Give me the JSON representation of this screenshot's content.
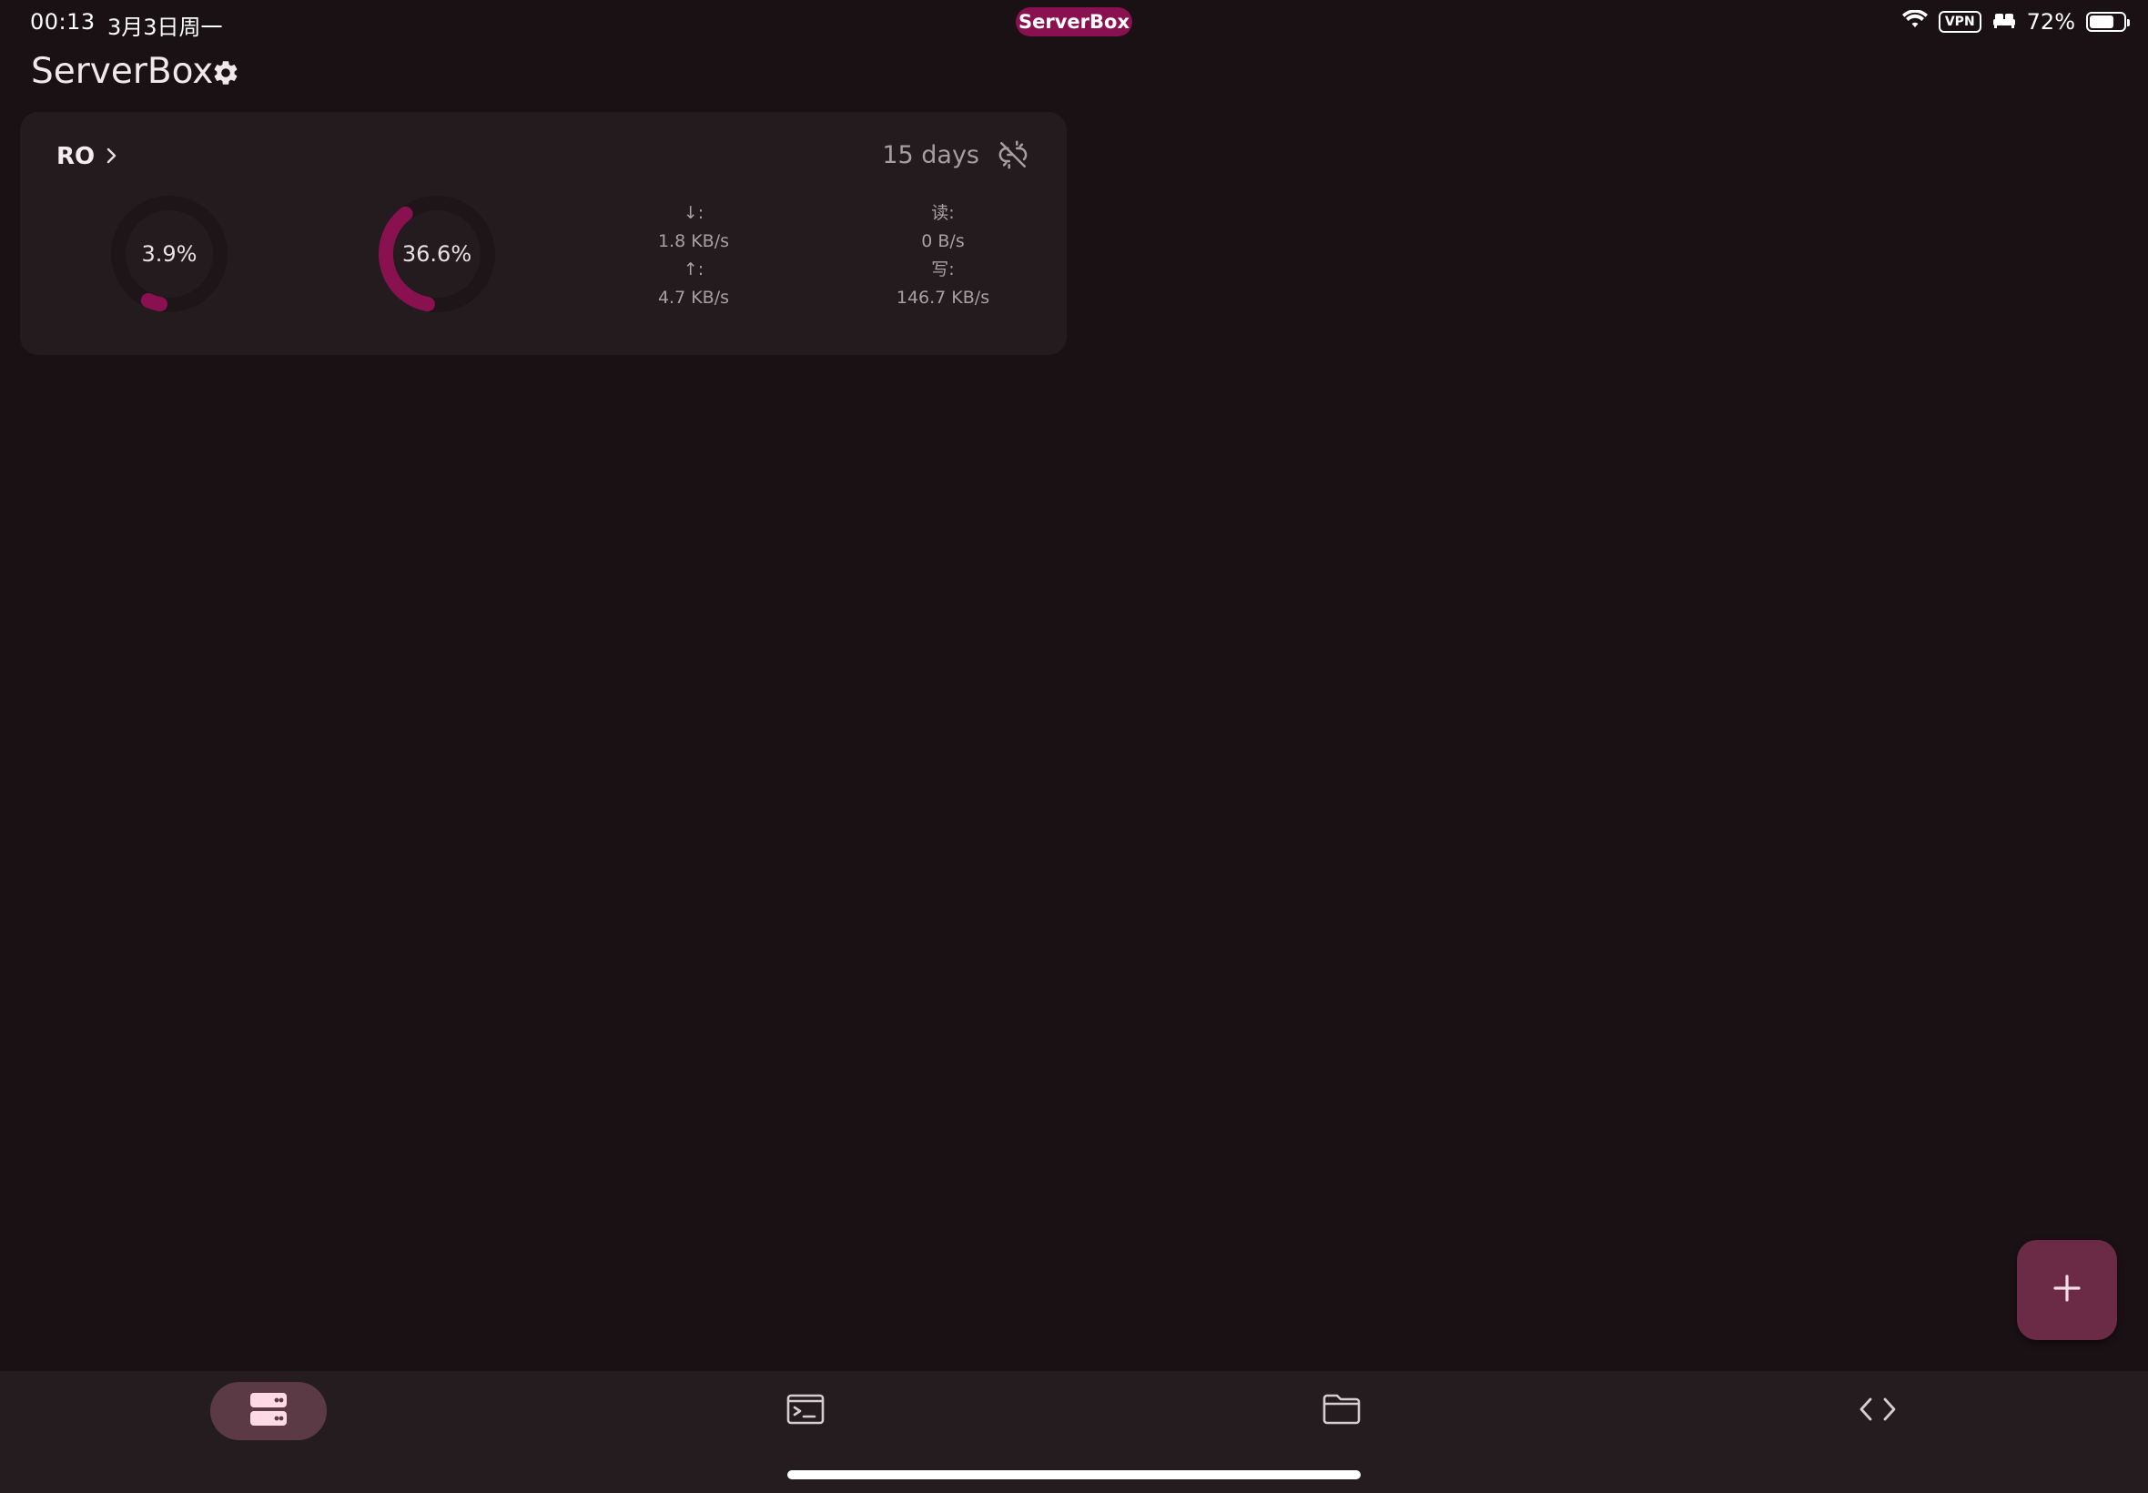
{
  "status_bar": {
    "time": "00:13",
    "date": "3月3日周一",
    "app_pill": "ServerBox",
    "vpn": "VPN",
    "battery": "72%",
    "battery_level": 0.72
  },
  "header": {
    "title": "ServerBox",
    "settings_icon": "gear-icon"
  },
  "server_card": {
    "name": "RO",
    "uptime": "15 days",
    "status_icon": "link-off-icon",
    "cpu": {
      "label": "3.9%",
      "percent": 3.9
    },
    "mem": {
      "label": "36.6%",
      "percent": 36.6
    },
    "network": {
      "down_label": "↓:",
      "down_value": "1.8 KB/s",
      "up_label": "↑:",
      "up_value": "4.7 KB/s"
    },
    "disk": {
      "read_label": "读:",
      "read_value": "0 B/s",
      "write_label": "写:",
      "write_value": "146.7 KB/s"
    }
  },
  "fab": {
    "icon": "plus-icon"
  },
  "bottom_nav": {
    "items": [
      {
        "icon": "servers-icon",
        "active": true
      },
      {
        "icon": "terminal-icon",
        "active": false
      },
      {
        "icon": "folder-icon",
        "active": false
      },
      {
        "icon": "code-icon",
        "active": false
      }
    ]
  },
  "colors": {
    "background": "#1a1114",
    "card": "#241b1f",
    "accent": "#8a1150",
    "fab": "#6b2a45",
    "nav_active": "#5b3a46"
  }
}
